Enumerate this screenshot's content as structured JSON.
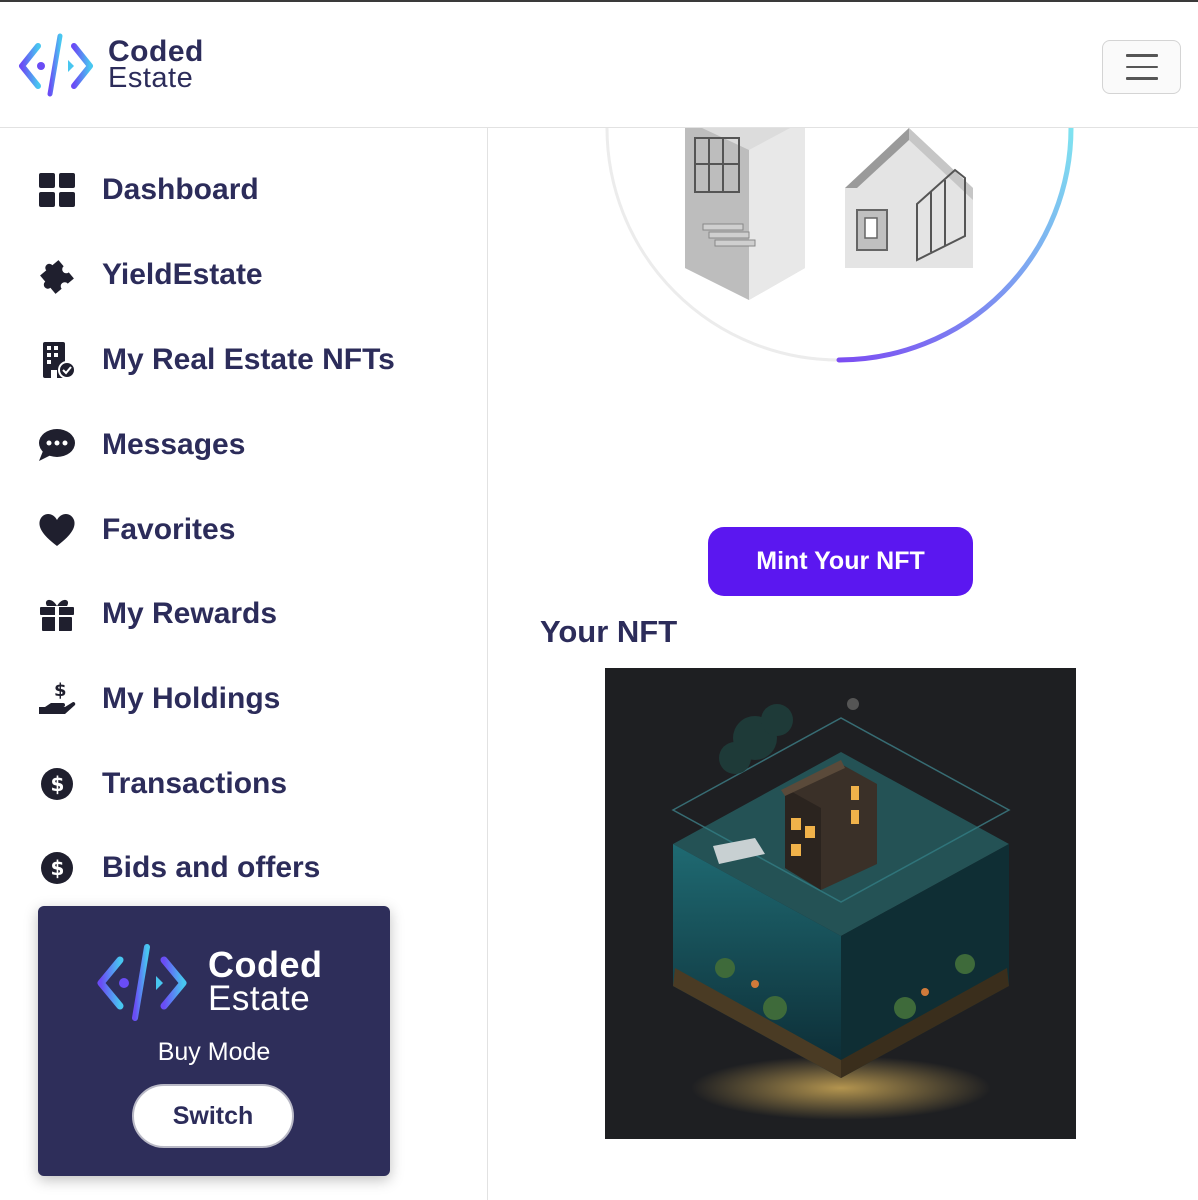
{
  "header": {
    "brand_line1": "Coded",
    "brand_line2": "Estate",
    "menu_icon": "hamburger-icon"
  },
  "sidebar": {
    "items": [
      {
        "label": "Dashboard",
        "icon": "dashboard-grid-icon"
      },
      {
        "label": "YieldEstate",
        "icon": "puzzle-piece-icon"
      },
      {
        "label": "My Real Estate NFTs",
        "icon": "building-check-icon"
      },
      {
        "label": "Messages",
        "icon": "chat-bubble-icon"
      },
      {
        "label": "Favorites",
        "icon": "heart-icon"
      },
      {
        "label": "My Rewards",
        "icon": "gift-icon"
      },
      {
        "label": "My Holdings",
        "icon": "hand-holding-dollar-icon"
      },
      {
        "label": "Transactions",
        "icon": "dollar-circle-icon"
      },
      {
        "label": "Bids and offers",
        "icon": "dollar-circle-icon"
      }
    ],
    "mode_card": {
      "brand_line1": "Coded",
      "brand_line2": "Estate",
      "mode_label": "Buy Mode",
      "switch_label": "Switch"
    }
  },
  "main": {
    "mint_button": "Mint Your NFT",
    "your_nft_heading": "Your NFT"
  },
  "colors": {
    "brand_text": "#2c2c5a",
    "mint_button": "#5b17f0",
    "mode_card_bg": "#2e2e5a",
    "logo_gradient_start": "#6a4cf5",
    "logo_gradient_end": "#48c6f0"
  }
}
